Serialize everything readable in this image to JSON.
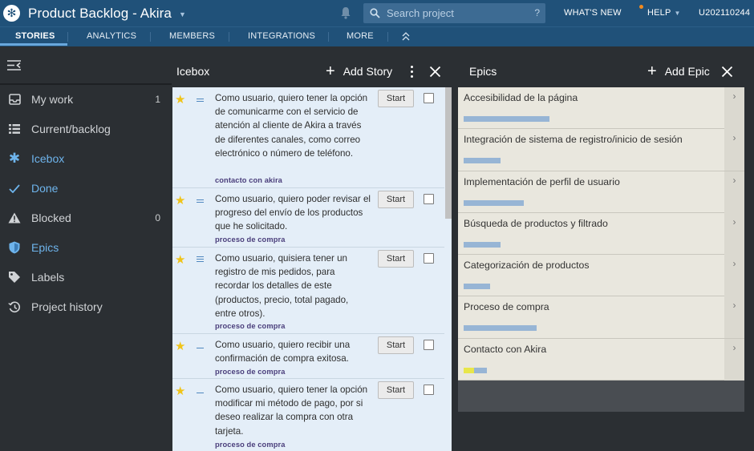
{
  "app": {
    "title": "Product Backlog - Akira",
    "search_placeholder": "Search project",
    "search_help": "?",
    "whats_new": "WHAT'S NEW",
    "help": "HELP",
    "user": "U202110244"
  },
  "nav": {
    "tabs": [
      "STORIES",
      "ANALYTICS",
      "MEMBERS",
      "INTEGRATIONS",
      "MORE"
    ],
    "active": "STORIES"
  },
  "sidebar": {
    "items": [
      {
        "label": "My work",
        "count": "1",
        "icon": "inbox-icon"
      },
      {
        "label": "Current/backlog",
        "count": "",
        "icon": "list-icon"
      },
      {
        "label": "Icebox",
        "count": "",
        "icon": "snowflake-icon"
      },
      {
        "label": "Done",
        "count": "",
        "icon": "check-icon"
      },
      {
        "label": "Blocked",
        "count": "0",
        "icon": "warning-icon"
      },
      {
        "label": "Epics",
        "count": "",
        "icon": "shield-icon"
      },
      {
        "label": "Labels",
        "count": "",
        "icon": "tag-icon"
      },
      {
        "label": "Project history",
        "count": "",
        "icon": "history-icon"
      }
    ]
  },
  "icebox": {
    "title": "Icebox",
    "add_label": "Add Story",
    "stories": [
      {
        "text": "Como usuario, quiero tener la opción de comunicarme con el servicio de atención al cliente de Akira a través de diferentes canales, como correo electrónico o número de teléfono.",
        "label": "contacto con akira",
        "button": "Start",
        "points": 2
      },
      {
        "text": "Como usuario, quiero poder revisar el progreso del envío de los productos que he solicitado.",
        "label": "proceso de compra",
        "button": "Start",
        "points": 2
      },
      {
        "text": "Como usuario, quisiera tener un registro de mis pedidos, para recordar los detalles de este (productos, precio, total pagado, entre otros).",
        "label": "proceso de compra",
        "button": "Start",
        "points": 3
      },
      {
        "text": "Como usuario, quiero recibir una confirmación de compra exitosa.",
        "label": "proceso de compra",
        "button": "Start",
        "points": 1
      },
      {
        "text": "Como usuario, quiero tener la opción modificar mi método de pago, por si deseo realizar la compra con otra tarjeta.",
        "label": "proceso de compra",
        "button": "Start",
        "points": 1
      }
    ]
  },
  "epics": {
    "title": "Epics",
    "add_label": "Add Epic",
    "items": [
      {
        "name": "Accesibilidad de la página",
        "progress": 0.33,
        "done": 0
      },
      {
        "name": "Integración de sistema de registro/inicio de sesión",
        "progress": 0.14,
        "done": 0
      },
      {
        "name": "Implementación de perfil de usuario",
        "progress": 0.23,
        "done": 0
      },
      {
        "name": "Búsqueda de productos y filtrado",
        "progress": 0.14,
        "done": 0
      },
      {
        "name": "Categorización de productos",
        "progress": 0.1,
        "done": 0
      },
      {
        "name": "Proceso de compra",
        "progress": 0.28,
        "done": 0
      },
      {
        "name": "Contacto con Akira",
        "progress": 0.09,
        "done": 0.04
      }
    ]
  },
  "colors": {
    "topbar": "#205179",
    "sidebar": "#2b2f33",
    "accent": "#6eb4ec",
    "story_bg": "#e4eef8",
    "epic_bg": "#e9e7de",
    "epic_bar": "#97b5d5",
    "star": "#f0c419"
  }
}
